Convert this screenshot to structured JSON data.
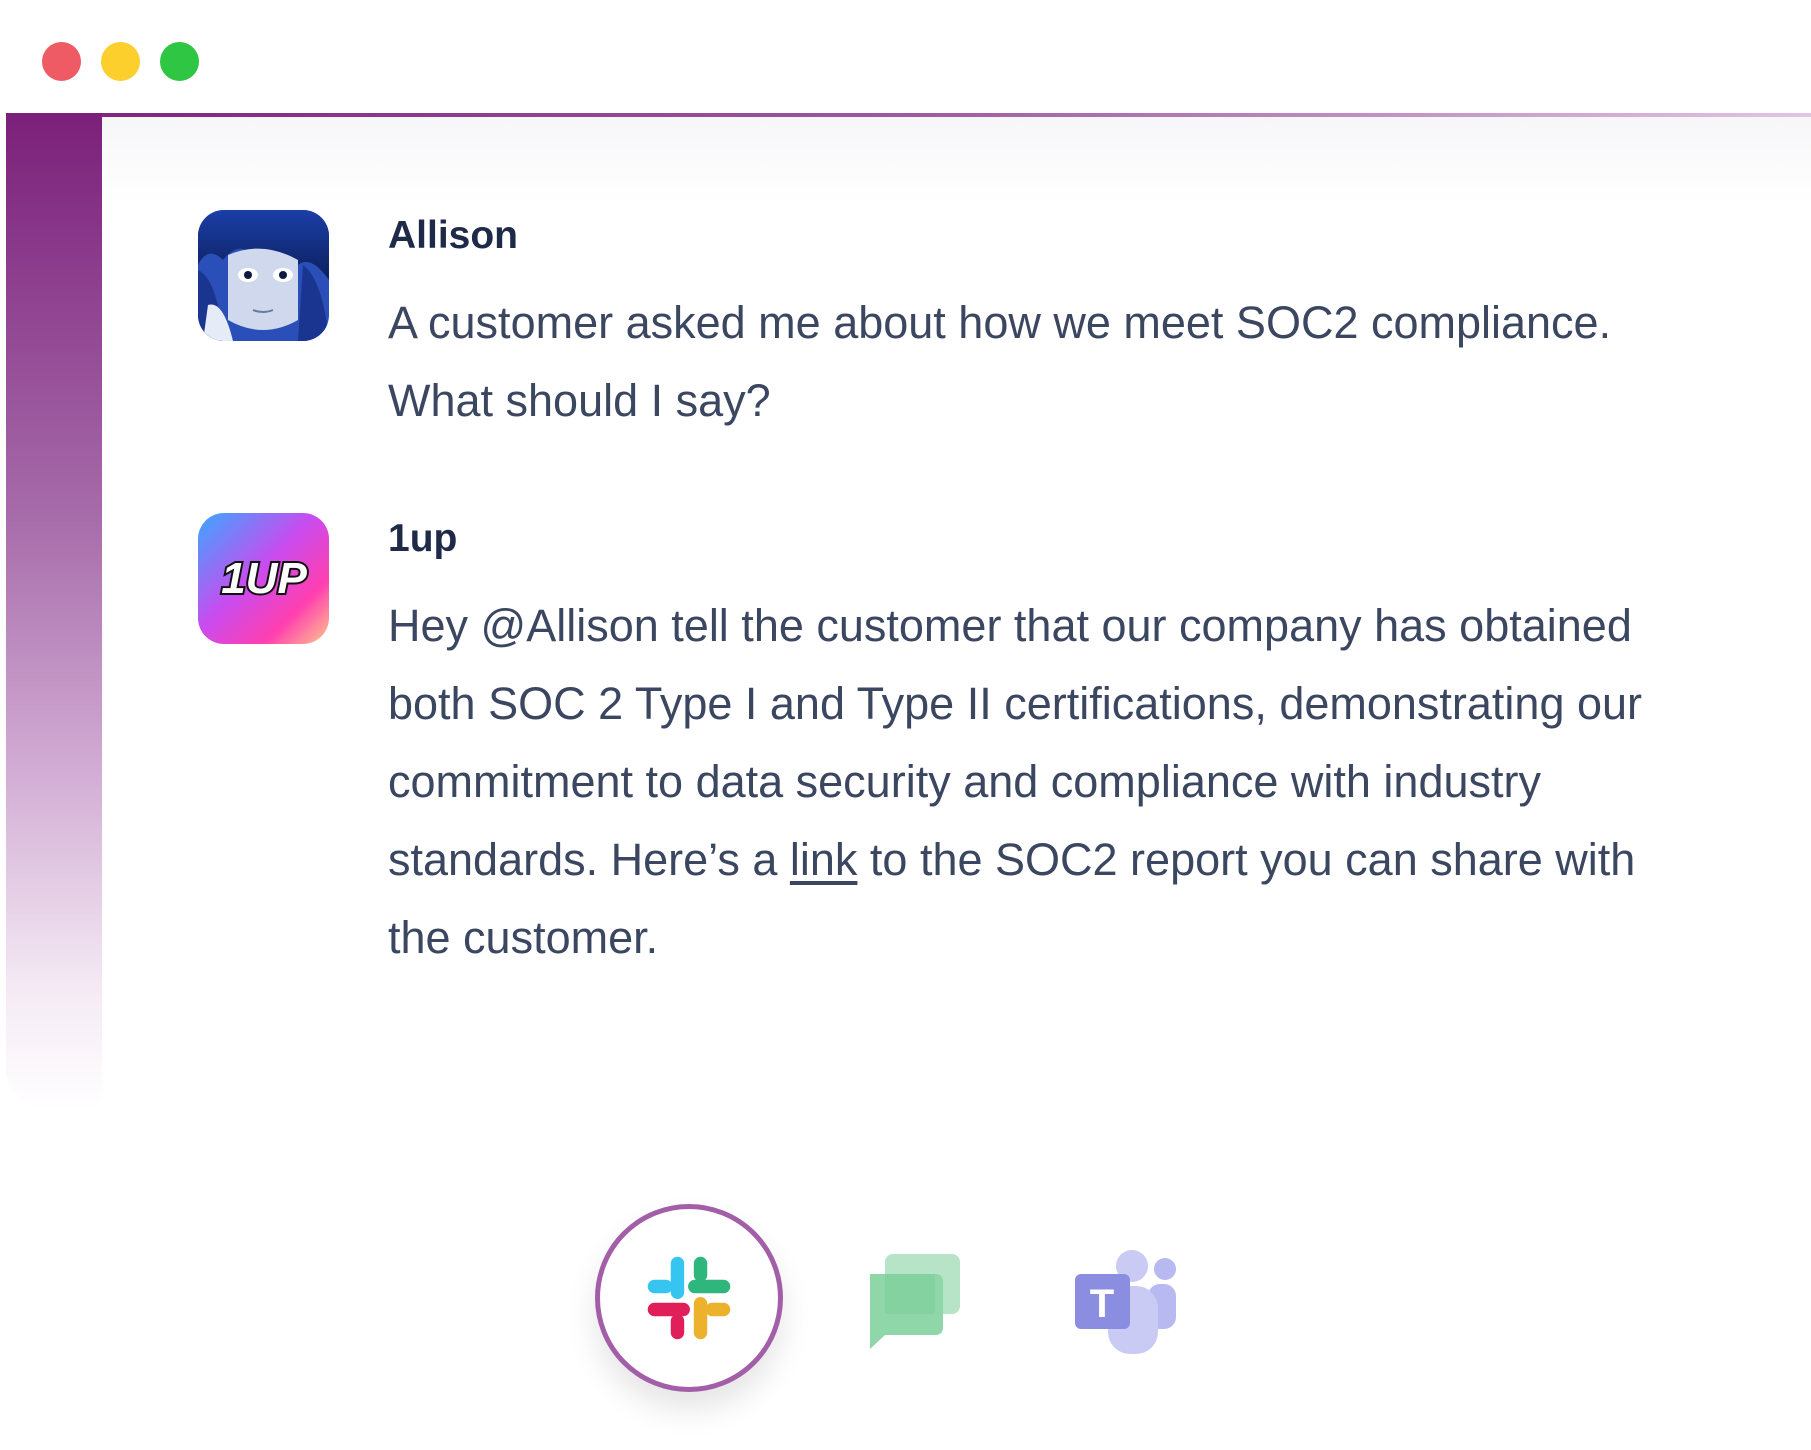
{
  "window": {
    "controls": [
      "close-dot",
      "minimize-dot",
      "maximize-dot"
    ],
    "colors": {
      "close": "#ee5b64",
      "minimize": "#fdcf2d",
      "maximize": "#2ec642",
      "accent": "#7b207a"
    }
  },
  "messages": [
    {
      "author": "Allison",
      "avatar": "anime-character-avatar",
      "text": "A customer asked me about how we meet SOC2 compliance. What should I say?"
    },
    {
      "author": "1up",
      "avatar": "1up-logo",
      "avatar_text": "1UP",
      "mention": "@Allison",
      "text_before": "Hey ",
      "text_middle": " tell the customer that our company has obtained both SOC 2 Type I and Type II certifications, demonstrating our commitment to data security and compliance with industry standards. Here’s a ",
      "link_label": "link",
      "text_after": " to the SOC2 report you can share with the customer."
    }
  ],
  "apps": [
    {
      "name": "slack-icon",
      "selected": true
    },
    {
      "name": "google-chat-icon",
      "selected": false
    },
    {
      "name": "microsoft-teams-icon",
      "selected": false
    }
  ]
}
